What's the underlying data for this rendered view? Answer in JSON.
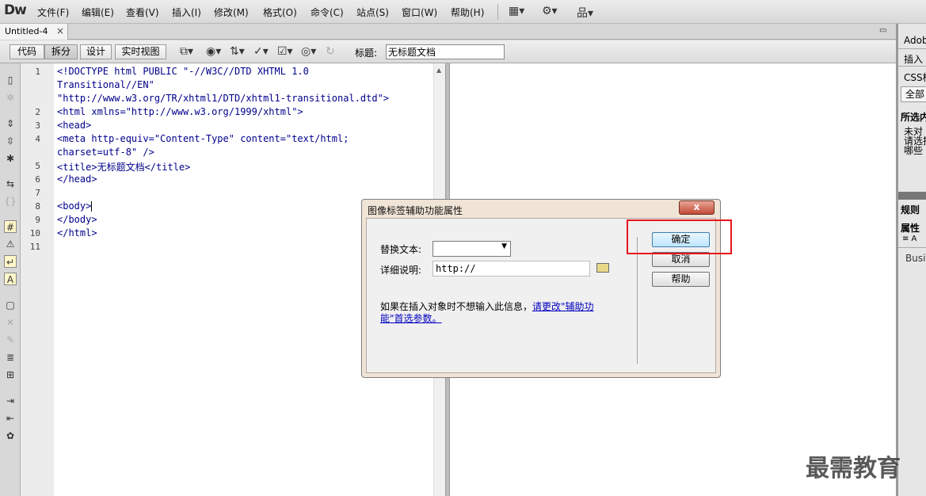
{
  "app": {
    "logo": "Dw"
  },
  "menubar": {
    "items": [
      "文件(F)",
      "编辑(E)",
      "查看(V)",
      "插入(I)",
      "修改(M)",
      "格式(O)",
      "命令(C)",
      "站点(S)",
      "窗口(W)",
      "帮助(H)"
    ]
  },
  "document": {
    "tab_title": "Untitled-4",
    "close_glyph": "×"
  },
  "toolbar": {
    "views": [
      "代码",
      "拆分",
      "设计",
      "实时视图"
    ],
    "active_view": "拆分",
    "title_label": "标题:",
    "title_value": "无标题文档"
  },
  "code": {
    "line_numbers": [
      "1",
      "2",
      "3",
      "4",
      "5",
      "6",
      "7",
      "8",
      "9",
      "10",
      "11"
    ],
    "lines": [
      "<!DOCTYPE html PUBLIC \"-//W3C//DTD XHTML 1.0",
      "Transitional//EN\"",
      "\"http://www.w3.org/TR/xhtml1/DTD/xhtml1-transitional.dtd\">",
      "<html xmlns=\"http://www.w3.org/1999/xhtml\">",
      "<head>",
      "<meta http-equiv=\"Content-Type\" content=\"text/html;",
      "charset=utf-8\" />",
      "<title>无标题文档</title>",
      "</head>",
      "",
      "<body>",
      "</body>",
      "</html>",
      ""
    ]
  },
  "right_panel": {
    "items": [
      "Adob",
      "插入",
      "CSS样",
      "全部",
      "所选内",
      "未对",
      "请选择",
      "哪些",
      "规则",
      "属性",
      "Busin"
    ]
  },
  "dialog": {
    "title": "图像标签辅助功能属性",
    "close_glyph": "x",
    "alt_label": "替换文本:",
    "alt_value": "",
    "longdesc_label": "详细说明:",
    "longdesc_value": "http://",
    "info_text": "如果在插入对象时不想输入此信息，",
    "info_link": "请更改\"辅助功能\"首选参数。",
    "ok_label": "确定",
    "cancel_label": "取消",
    "help_label": "帮助"
  },
  "watermark": {
    "text": "最需教育"
  },
  "colors": {
    "highlight_box": "#e8141c",
    "code_text": "#00008b",
    "link": "#0000c0"
  }
}
